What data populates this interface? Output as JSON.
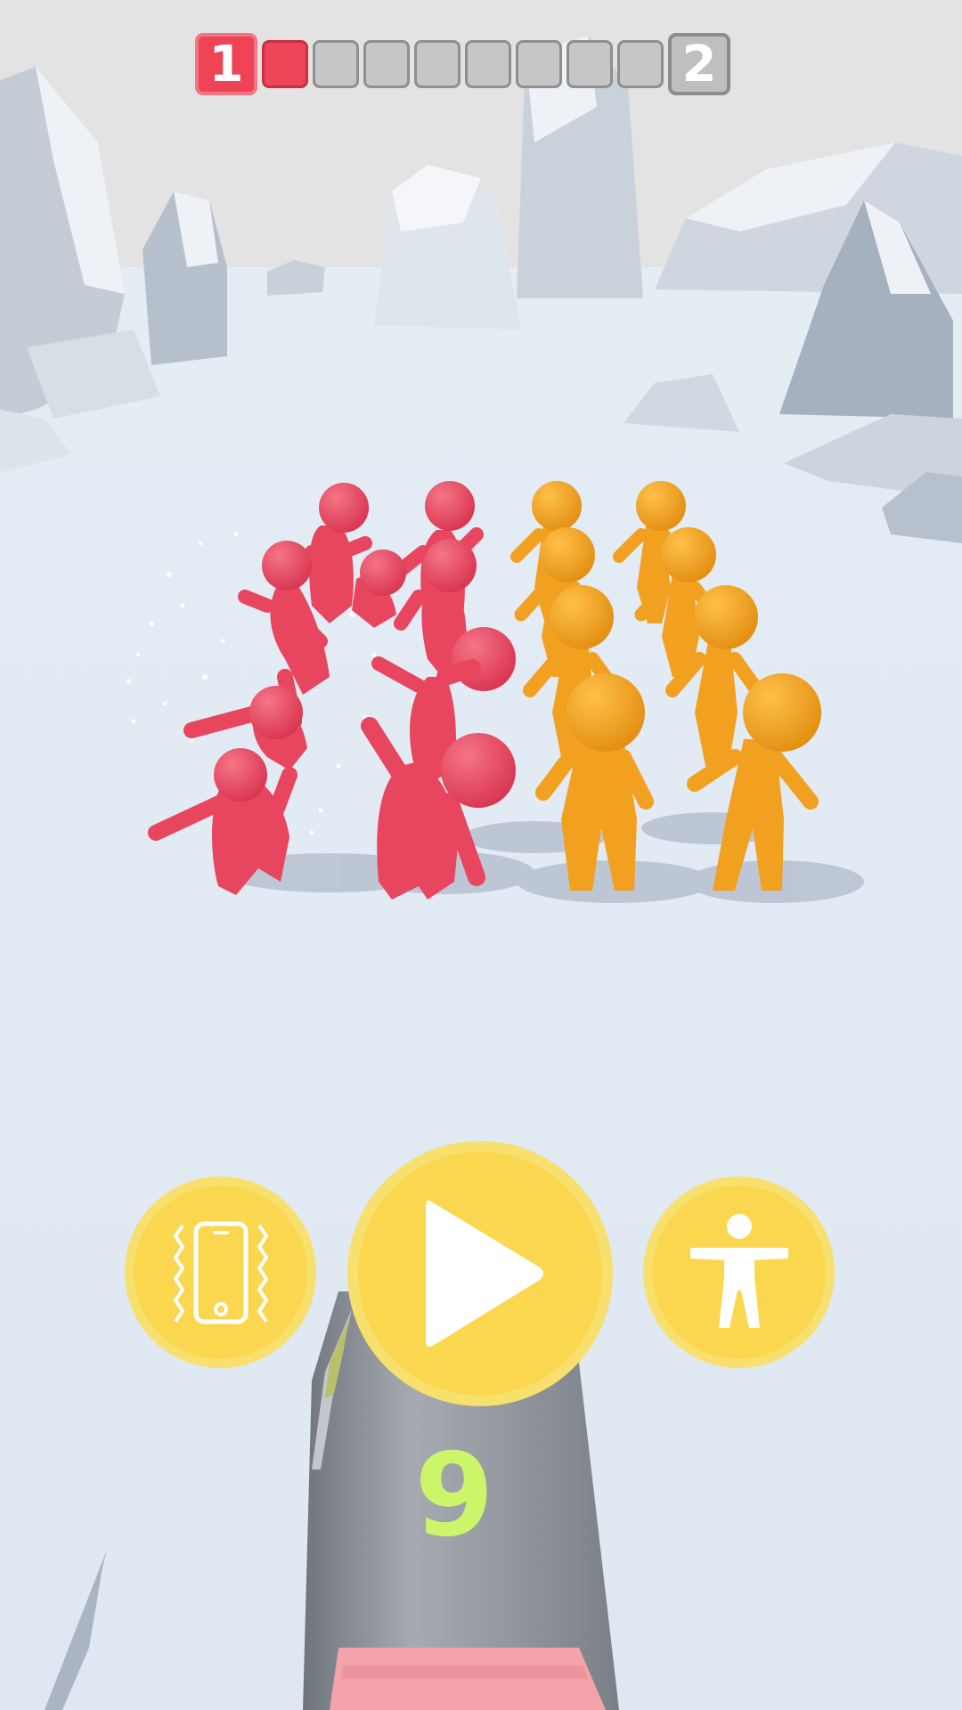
{
  "level_progress": {
    "current_level": "1",
    "next_level": "2",
    "stages_total": 8,
    "stages_completed": 1,
    "current_color": "#ef4456",
    "pending_color": "#c6c6c6"
  },
  "buttons": {
    "vibration": {
      "icon": "phone-vibration-icon"
    },
    "play": {
      "icon": "play-icon"
    },
    "accessibility": {
      "icon": "person-figure-icon"
    }
  },
  "ammo_count": "9",
  "crowds": {
    "enemy_color": "#e8455f",
    "ally_color": "#f2a020"
  }
}
